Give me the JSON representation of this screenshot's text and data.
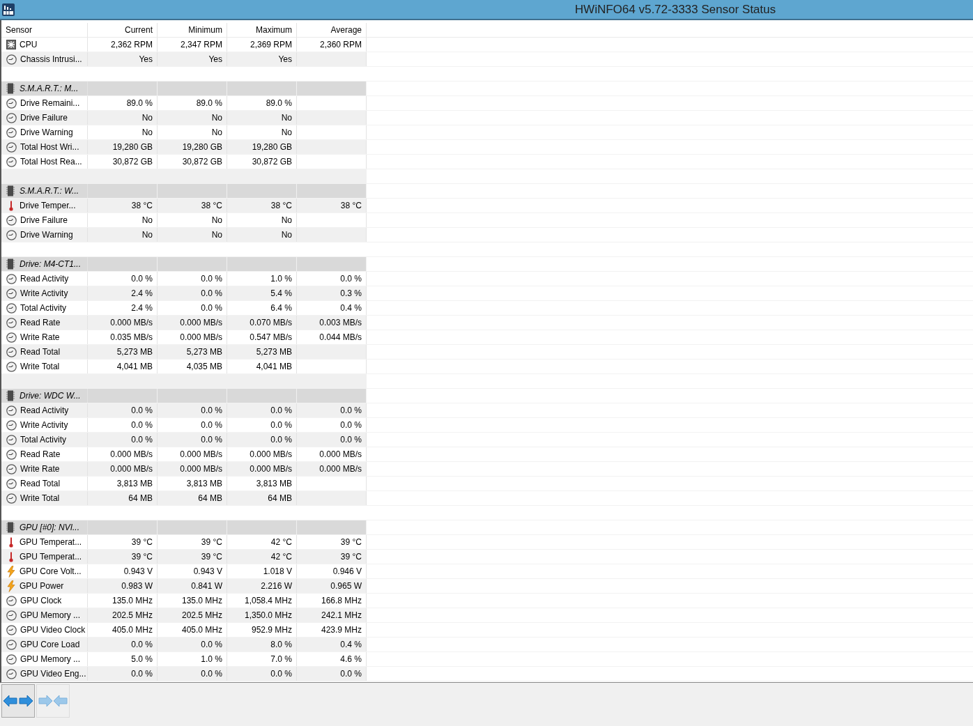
{
  "window": {
    "title": "HWiNFO64 v5.72-3333 Sensor Status"
  },
  "columns": [
    "Sensor",
    "Current",
    "Minimum",
    "Maximum",
    "Average"
  ],
  "rows": [
    {
      "kind": "fan",
      "name": "CPU",
      "current": "2,362 RPM",
      "minimum": "2,347 RPM",
      "maximum": "2,369 RPM",
      "average": "2,360 RPM"
    },
    {
      "kind": "status",
      "name": "Chassis Intrusi...",
      "current": "Yes",
      "minimum": "Yes",
      "maximum": "Yes"
    },
    {
      "kind": "blank"
    },
    {
      "kind": "group",
      "name": "S.M.A.R.T.: M..."
    },
    {
      "kind": "status",
      "name": "Drive Remaini...",
      "current": "89.0 %",
      "minimum": "89.0 %",
      "maximum": "89.0 %"
    },
    {
      "kind": "status",
      "name": "Drive Failure",
      "current": "No",
      "minimum": "No",
      "maximum": "No"
    },
    {
      "kind": "status",
      "name": "Drive Warning",
      "current": "No",
      "minimum": "No",
      "maximum": "No"
    },
    {
      "kind": "status",
      "name": "Total Host Wri...",
      "current": "19,280 GB",
      "minimum": "19,280 GB",
      "maximum": "19,280 GB"
    },
    {
      "kind": "status",
      "name": "Total Host Rea...",
      "current": "30,872 GB",
      "minimum": "30,872 GB",
      "maximum": "30,872 GB"
    },
    {
      "kind": "blank"
    },
    {
      "kind": "group",
      "name": "S.M.A.R.T.: W..."
    },
    {
      "kind": "temperature",
      "name": "Drive Temper...",
      "current": "38 °C",
      "minimum": "38 °C",
      "maximum": "38 °C",
      "average": "38 °C"
    },
    {
      "kind": "status",
      "name": "Drive Failure",
      "current": "No",
      "minimum": "No",
      "maximum": "No"
    },
    {
      "kind": "status",
      "name": "Drive Warning",
      "current": "No",
      "minimum": "No",
      "maximum": "No"
    },
    {
      "kind": "blank"
    },
    {
      "kind": "group",
      "name": "Drive: M4-CT1..."
    },
    {
      "kind": "status",
      "name": "Read Activity",
      "current": "0.0 %",
      "minimum": "0.0 %",
      "maximum": "1.0 %",
      "average": "0.0 %"
    },
    {
      "kind": "status",
      "name": "Write Activity",
      "current": "2.4 %",
      "minimum": "0.0 %",
      "maximum": "5.4 %",
      "average": "0.3 %"
    },
    {
      "kind": "status",
      "name": "Total Activity",
      "current": "2.4 %",
      "minimum": "0.0 %",
      "maximum": "6.4 %",
      "average": "0.4 %"
    },
    {
      "kind": "status",
      "name": "Read Rate",
      "current": "0.000 MB/s",
      "minimum": "0.000 MB/s",
      "maximum": "0.070 MB/s",
      "average": "0.003 MB/s"
    },
    {
      "kind": "status",
      "name": "Write Rate",
      "current": "0.035 MB/s",
      "minimum": "0.000 MB/s",
      "maximum": "0.547 MB/s",
      "average": "0.044 MB/s"
    },
    {
      "kind": "status",
      "name": "Read Total",
      "current": "5,273 MB",
      "minimum": "5,273 MB",
      "maximum": "5,273 MB"
    },
    {
      "kind": "status",
      "name": "Write Total",
      "current": "4,041 MB",
      "minimum": "4,035 MB",
      "maximum": "4,041 MB"
    },
    {
      "kind": "blank"
    },
    {
      "kind": "group",
      "name": "Drive: WDC W..."
    },
    {
      "kind": "status",
      "name": "Read Activity",
      "current": "0.0 %",
      "minimum": "0.0 %",
      "maximum": "0.0 %",
      "average": "0.0 %"
    },
    {
      "kind": "status",
      "name": "Write Activity",
      "current": "0.0 %",
      "minimum": "0.0 %",
      "maximum": "0.0 %",
      "average": "0.0 %"
    },
    {
      "kind": "status",
      "name": "Total Activity",
      "current": "0.0 %",
      "minimum": "0.0 %",
      "maximum": "0.0 %",
      "average": "0.0 %"
    },
    {
      "kind": "status",
      "name": "Read Rate",
      "current": "0.000 MB/s",
      "minimum": "0.000 MB/s",
      "maximum": "0.000 MB/s",
      "average": "0.000 MB/s"
    },
    {
      "kind": "status",
      "name": "Write Rate",
      "current": "0.000 MB/s",
      "minimum": "0.000 MB/s",
      "maximum": "0.000 MB/s",
      "average": "0.000 MB/s"
    },
    {
      "kind": "status",
      "name": "Read Total",
      "current": "3,813 MB",
      "minimum": "3,813 MB",
      "maximum": "3,813 MB"
    },
    {
      "kind": "status",
      "name": "Write Total",
      "current": "64 MB",
      "minimum": "64 MB",
      "maximum": "64 MB"
    },
    {
      "kind": "blank"
    },
    {
      "kind": "group",
      "name": "GPU [#0]: NVI..."
    },
    {
      "kind": "temperature",
      "name": "GPU Temperat...",
      "current": "39 °C",
      "minimum": "39 °C",
      "maximum": "42 °C",
      "average": "39 °C"
    },
    {
      "kind": "temperature",
      "name": "GPU Temperat...",
      "current": "39 °C",
      "minimum": "39 °C",
      "maximum": "42 °C",
      "average": "39 °C"
    },
    {
      "kind": "power",
      "name": "GPU Core Volt...",
      "current": "0.943 V",
      "minimum": "0.943 V",
      "maximum": "1.018 V",
      "average": "0.946 V"
    },
    {
      "kind": "power",
      "name": "GPU Power",
      "current": "0.983 W",
      "minimum": "0.841 W",
      "maximum": "2.216 W",
      "average": "0.965 W"
    },
    {
      "kind": "status",
      "name": "GPU Clock",
      "current": "135.0 MHz",
      "minimum": "135.0 MHz",
      "maximum": "1,058.4 MHz",
      "average": "166.8 MHz"
    },
    {
      "kind": "status",
      "name": "GPU Memory ...",
      "current": "202.5 MHz",
      "minimum": "202.5 MHz",
      "maximum": "1,350.0 MHz",
      "average": "242.1 MHz"
    },
    {
      "kind": "status",
      "name": "GPU Video Clock",
      "current": "405.0 MHz",
      "minimum": "405.0 MHz",
      "maximum": "952.9 MHz",
      "average": "423.9 MHz"
    },
    {
      "kind": "status",
      "name": "GPU Core Load",
      "current": "0.0 %",
      "minimum": "0.0 %",
      "maximum": "8.0 %",
      "average": "0.4 %"
    },
    {
      "kind": "status",
      "name": "GPU Memory ...",
      "current": "5.0 %",
      "minimum": "1.0 %",
      "maximum": "7.0 %",
      "average": "4.6 %"
    },
    {
      "kind": "status",
      "name": "GPU Video Eng...",
      "current": "0.0 %",
      "minimum": "0.0 %",
      "maximum": "0.0 %",
      "average": "0.0 %"
    }
  ],
  "toolbar": [
    {
      "kind": "expand",
      "disabled": false
    },
    {
      "kind": "collapse",
      "disabled": true
    }
  ]
}
